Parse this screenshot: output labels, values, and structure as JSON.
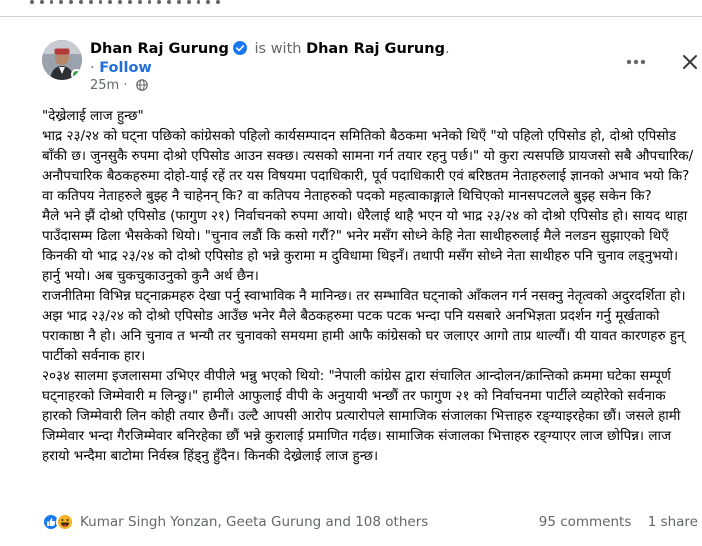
{
  "post": {
    "author": "Dhan Raj Gurung",
    "is_with": "is with",
    "tagged": "Dhan Raj Gurung",
    "period": ".",
    "separator": "·",
    "follow_label": "Follow",
    "timestamp": "25m",
    "timestamp_sep": "·",
    "more_icon": "ellipsis-icon",
    "close_icon": "close-icon",
    "audience_icon": "globe-icon",
    "paragraphs": [
      "\"देख्रेलाई लाज हुन्छ\"",
      "भाद्र २३/२४ को घट्ना पछिको कांग्रेसको पहिलो कार्यसम्पादन समितिको बैठकमा भनेको थिएँ \"यो पहिलो एपिसोड हो, दोश्रो एपिसोड बाँकी छ। जुनसुकै रुपमा दोश्रो एपिसोड आउन सक्छ। त्यसको सामना गर्न तयार रहनु पर्छ।\" यो कुरा त्यसपछि प्रायजसो सबै औपचारिक/अनौपचारिक बैठकहरुमा दोहो-याई रहें तर यस विषयमा पदाधिकारी, पूर्व पदाधिकारी एवं बरिष्ठतम नेताहरुलाई ज्ञानको अभाव भयो कि? वा कतिपय नेताहरुले बुझ्ह नै चाहेनन् कि? वा कतिपय नेताहरुको पदको महत्वाकाङ्गाले थिचिएको मानसपटलले बुझ्ह सकेन कि?",
      "मैले भने झैं दोश्रो एपिसोड (फागुण २१) निर्वाचनको रुपमा आयो। धेरैलाई थाहै भएन यो भाद्र २३/२४ को दोश्रो एपिसोड हो। सायद थाहा पाउँदासम्म ढिला भैसकेको थियो। \"चुनाव लडौं कि कसो गरौं?\" भनेर मसँग सोध्ने केहि नेता साथीहरुलाई मैले नलडन सुझाएको थिएँ किनकी यो भाद्र २३/२४ को दोश्रो एपिसोड हो भन्ने कुरामा म दुविधामा थिइनँ। तथापी मसँग सोध्ने नेता साथीहरु पनि चुनाव लड्नुभयो। हार्नु भयो। अब चुकचुकाउनुको कुनै अर्थ छैन।",
      "राजनीतिमा विभिन्न घट्नाक्रमहरु देखा पर्नु स्वाभाविक नै मानिन्छ। तर सम्भावित घट्नाको आँकलन गर्न नसक्नु नेतृत्वको अदुरदर्शिता हो। अझ भाद्र २३/२४ को दोश्रो एपिसोड आउँछ भनेर मैले बैठकहरुमा पटक पटक भन्दा पनि यसबारे अनभिज्ञता प्रदर्शन गर्नु मूर्खताको पराकाष्ठा नै हो। अनि चुनाव त भन्यौ तर चुनावको समयमा हामी आफै कांग्रेसको घर जलाएर आगो ताप्र थाल्यौं। यी यावत कारणहरु हुन् पार्टीको सर्वनाक हार।",
      "२०३४ सालमा इजलासमा उभिएर वीपीले भन्नु भएको थियो: \"नेपाली कांग्रेस द्वारा संचालित आन्दोलन/क्रान्तिको क्रममा घटेका सम्पूर्ण घट्नाहरको जिम्मेवारी म लिन्छु।\" हामीले आफुलाई वीपी के अनुयायी भन्छौं तर फागुण २१ को निर्वाचनमा पार्टीले व्यहोरेको सर्वनाक हारको जिम्मेवारी लिन कोही तयार छैनौं। उल्टै आपसी आरोप प्रत्यारोपले सामाजिक संजालका भित्ताहरु रङ्ग्याइरहेका छौं। जसले हामी जिम्मेवार भन्दा गैरजिम्मेवार बनिरहेका छौं भन्ने कुरालाई प्रमाणित गर्दछ। सामाजिक संजालका भित्ताहरु रङ्ग्याएर लाज छोपिन्न। लाज हरायो भन्दैमा बाटोमा निर्वस्त्र हिंड्नु हुँदैन। किनकी देख्रेलाई लाज हुन्छ।"
    ],
    "reactions": [
      "like-reaction-icon",
      "haha-reaction-icon"
    ],
    "reactors_text": "Kumar Singh Yonzan, Geeta Gurung and 108 others",
    "comments_text": "95 comments",
    "shares_text": "1 share",
    "colors": {
      "follow": "#216fdb",
      "secondary_text": "#65676b",
      "like": "#1877f2",
      "haha": "#f7b125",
      "online": "#31a24c"
    }
  }
}
